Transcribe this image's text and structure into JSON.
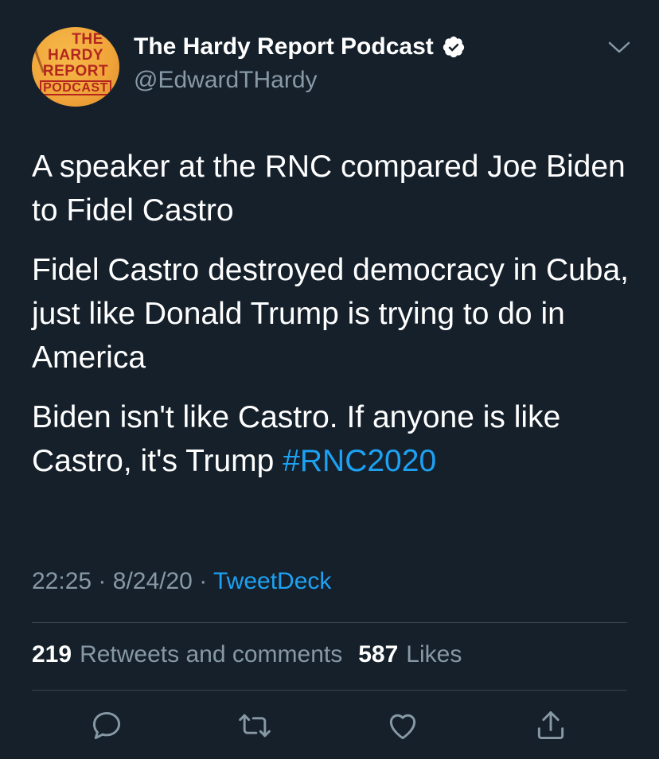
{
  "tweet": {
    "display_name": "The Hardy Report Podcast",
    "handle": "@EdwardTHardy",
    "verified": true,
    "avatar_text": {
      "line1": "THE",
      "line2": "HARDY",
      "line3": "REPORT",
      "line4": "PODCAST"
    },
    "paragraphs": [
      "A speaker at the RNC compared Joe Biden to Fidel Castro",
      "Fidel Castro destroyed democracy in Cuba, just like Donald Trump is trying to do in America",
      "Biden isn't like Castro. If anyone is like Castro, it's Trump "
    ],
    "hashtag": "#RNC2020",
    "time": "22:25",
    "date": "8/24/20",
    "separator": "·",
    "source": "TweetDeck",
    "retweets_count": "219",
    "retweets_label": "Retweets and comments",
    "likes_count": "587",
    "likes_label": "Likes"
  },
  "colors": {
    "background": "#15202b",
    "text": "#ffffff",
    "muted": "#8899a6",
    "accent": "#1da1f2",
    "divider": "#38444d"
  },
  "icons": [
    "verified-icon",
    "chevron-down-icon",
    "reply-icon",
    "retweet-icon",
    "like-icon",
    "share-icon"
  ]
}
